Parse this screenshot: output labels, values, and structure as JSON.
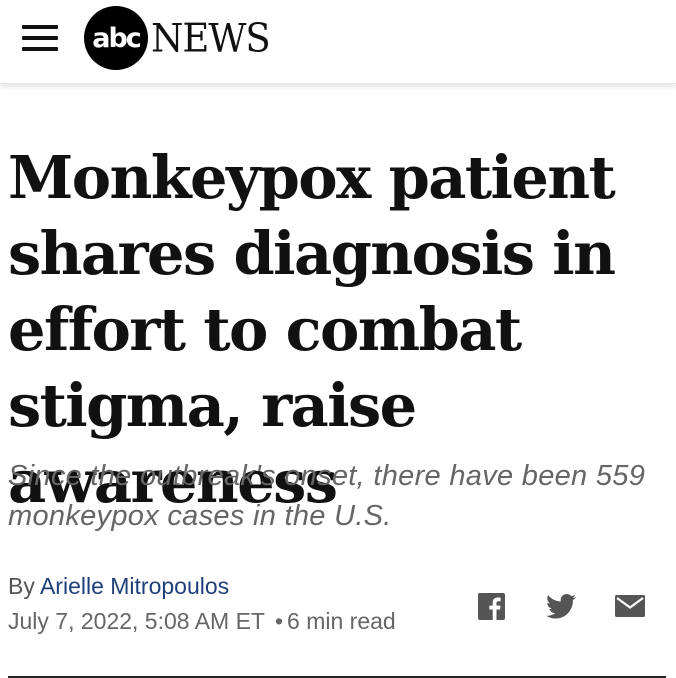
{
  "header": {
    "logo_circle_text": "abc",
    "logo_word": "NEWS"
  },
  "article": {
    "headline": "Monkeypox patient shares diagnosis in effort to combat stigma, raise awareness",
    "subhead": "Since the outbreak's onset, there have been 559 monkeypox cases in the U.S.",
    "byline_prefix": "By",
    "author": "Arielle Mitropoulos",
    "date": "July 7, 2022, 5:08 AM ET",
    "separator": "•",
    "read_time": "6 min read"
  },
  "share": {
    "icons": [
      "facebook-icon",
      "twitter-icon",
      "email-icon"
    ]
  },
  "colors": {
    "author_link": "#1f3f7a",
    "text": "#111111",
    "muted": "#666666"
  }
}
